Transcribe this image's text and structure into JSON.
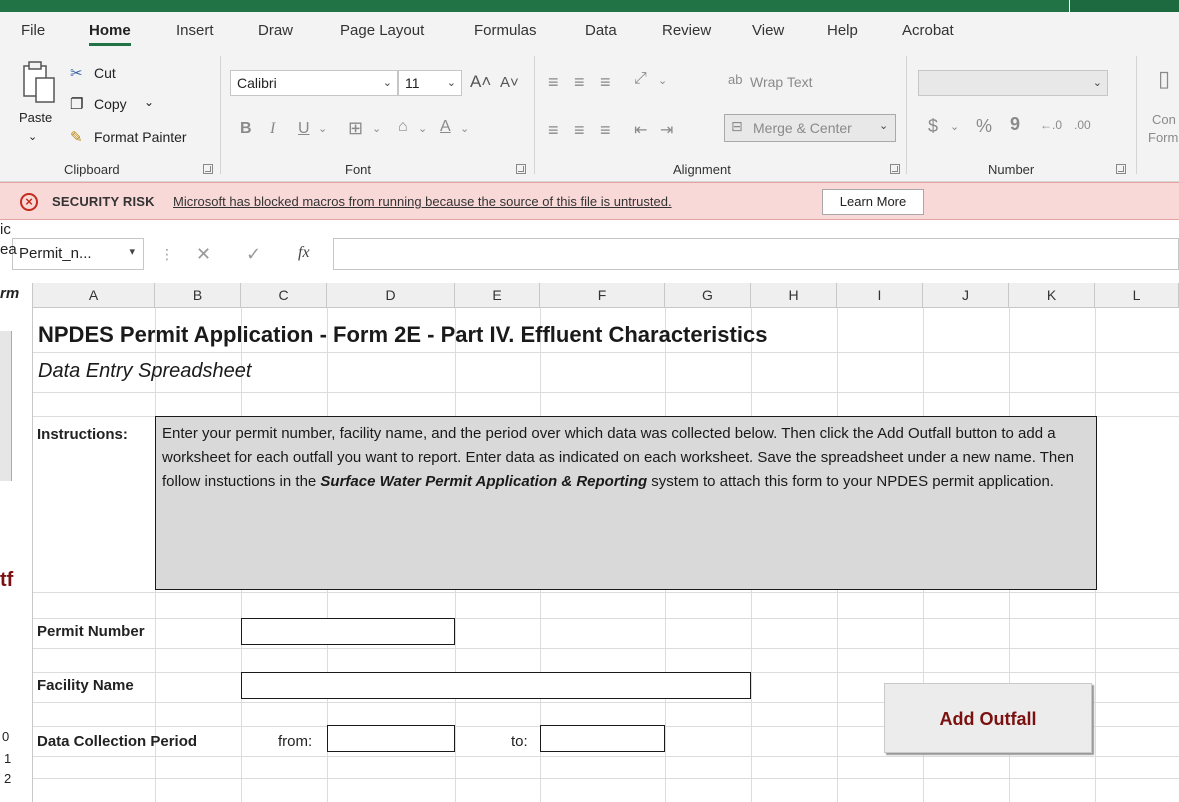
{
  "ribbon_tabs": [
    {
      "label": "File"
    },
    {
      "label": "Home"
    },
    {
      "label": "Insert"
    },
    {
      "label": "Draw"
    },
    {
      "label": "Page Layout"
    },
    {
      "label": "Formulas"
    },
    {
      "label": "Data"
    },
    {
      "label": "Review"
    },
    {
      "label": "View"
    },
    {
      "label": "Help"
    },
    {
      "label": "Acrobat"
    }
  ],
  "ribbon": {
    "clipboard": {
      "paste": "Paste",
      "cut": "Cut",
      "copy": "Copy",
      "format_painter": "Format Painter",
      "group_label": "Clipboard"
    },
    "font": {
      "font_name": "Calibri",
      "font_size": "11",
      "group_label": "Font"
    },
    "alignment": {
      "wrap_text": "Wrap Text",
      "merge_center": "Merge & Center",
      "group_label": "Alignment"
    },
    "number": {
      "currency": "$",
      "percent": "%",
      "comma": "9",
      "group_label": "Number"
    },
    "cut_off": {
      "line1": "Con",
      "line2": "Form"
    }
  },
  "security_bar": {
    "title": "SECURITY RISK",
    "message": "Microsoft has blocked macros from running because the source of this file is untrusted.",
    "button": "Learn More"
  },
  "formula_bar": {
    "name_box": "Permit_n...",
    "fx": "fx"
  },
  "columns": [
    "A",
    "B",
    "C",
    "D",
    "E",
    "F",
    "G",
    "H",
    "I",
    "J",
    "K",
    "L"
  ],
  "sheet": {
    "title": "NPDES Permit Application - Form 2E - Part IV. Effluent Characteristics",
    "subtitle": "Data Entry Spreadsheet",
    "instructions_label": "Instructions:",
    "instructions_part1": "Enter your permit number, facility name, and the period over which data was collected below.  Then click the Add Outfall button to add a worksheet for each outfall you want to report.  Enter data as indicated on each worksheet.  Save the spreadsheet under a new name.  Then follow instuctions in the ",
    "instructions_emphasis": "Surface Water Permit Application & Reporting",
    "instructions_part2": "  system  to attach this form to your NPDES permit application.",
    "permit_number_label": "Permit Number",
    "facility_name_label": "Facility Name",
    "data_collection_label": "Data Collection Period",
    "from_label": "from:",
    "to_label": "to:",
    "add_outfall_button": "Add Outfall"
  },
  "left_sliver": {
    "text1": "ic",
    "text2": "ea",
    "text3": "rm",
    "text4": "tf",
    "row1": "0",
    "row2": "1",
    "row3": "2"
  },
  "colors": {
    "excel_green": "#217346",
    "security_red": "#c42b1c",
    "button_text": "#7a1010",
    "instruction_fill": "#d9d9d9"
  }
}
